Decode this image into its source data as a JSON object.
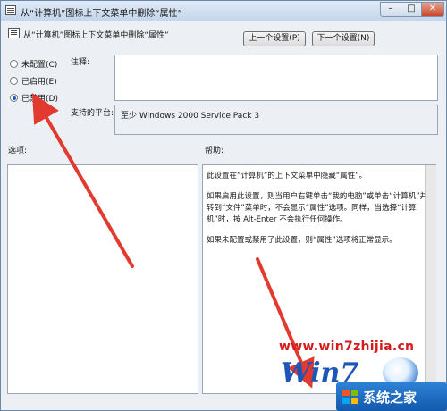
{
  "window": {
    "title": "从“计算机”图标上下文菜单中删除“属性”"
  },
  "header": {
    "title": "从“计算机”图标上下文菜单中删除“属性”",
    "prev_button": "上一个设置(P)",
    "next_button": "下一个设置(N)"
  },
  "options": [
    {
      "label": "未配置(C)",
      "checked": false
    },
    {
      "label": "已启用(E)",
      "checked": false
    },
    {
      "label": "已禁用(D)",
      "checked": true
    }
  ],
  "comment": {
    "label": "注释:",
    "value": ""
  },
  "platform": {
    "label": "支持的平台:",
    "value": "至少 Windows 2000 Service Pack 3"
  },
  "sections": {
    "options_label": "选项:",
    "help_label": "帮助:"
  },
  "help": {
    "p1": "此设置在“计算机”的上下文菜单中隐藏“属性”。",
    "p2": "如果启用此设置，则当用户右键单击“我的电脑”或单击“计算机”并转到“文件”菜单时，不会显示“属性”选项。同样，当选择“计算机”时，按 Alt-Enter 不会执行任何操作。",
    "p3": "如果未配置或禁用了此设置，则“属性”选项将正常显示。"
  },
  "watermark": {
    "url": "www.win7zhijia.cn",
    "logo": "Win7",
    "badge_text": "系统之家"
  },
  "colors": {
    "arrow": "#e23a2e",
    "accent": "#1e5bb8"
  }
}
